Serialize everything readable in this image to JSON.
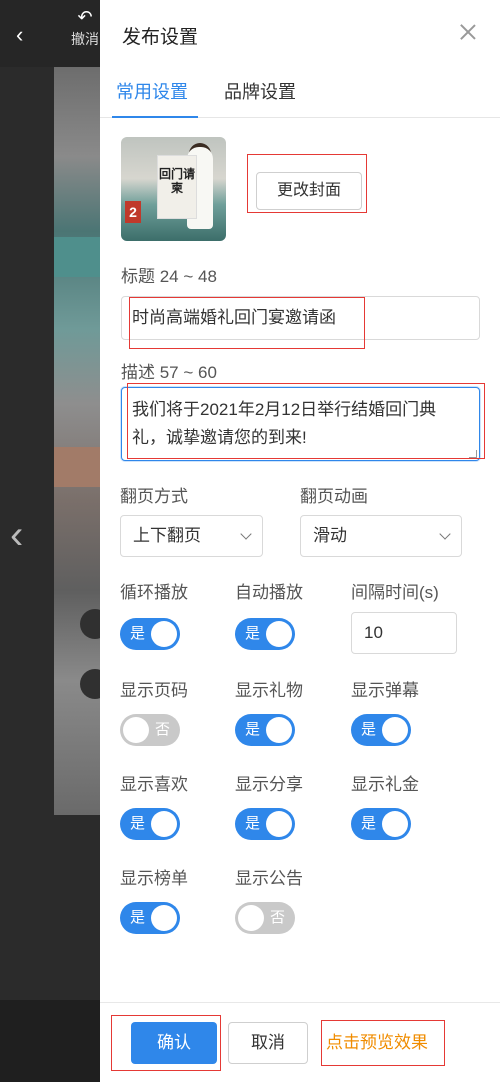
{
  "background": {
    "back_icon": "‹",
    "undo_label": "撤消",
    "prev_page_icon": "‹"
  },
  "panel": {
    "title": "发布设置",
    "tabs": [
      {
        "label": "常用设置",
        "active": true
      },
      {
        "label": "品牌设置",
        "active": false
      }
    ],
    "cover": {
      "thumb_text": "回门请柬",
      "thumb_number": "2",
      "change_button": "更改封面"
    },
    "title_field": {
      "label": "标题 24 ~ 48",
      "value": "时尚高端婚礼回门宴邀请函"
    },
    "desc_field": {
      "label": "描述 57 ~ 60",
      "value": "我们将于2021年2月12日举行结婚回门典礼，诚挚邀请您的到来!"
    },
    "page_mode": {
      "label": "翻页方式",
      "value": "上下翻页"
    },
    "page_anim": {
      "label": "翻页动画",
      "value": "滑动"
    },
    "toggles": {
      "loop": {
        "label": "循环播放",
        "state": "是",
        "on": true
      },
      "autoplay": {
        "label": "自动播放",
        "state": "是",
        "on": true
      },
      "page_num": {
        "label": "显示页码",
        "state": "否",
        "on": false
      },
      "gift": {
        "label": "显示礼物",
        "state": "是",
        "on": true
      },
      "danmaku": {
        "label": "显示弹幕",
        "state": "是",
        "on": true
      },
      "like": {
        "label": "显示喜欢",
        "state": "是",
        "on": true
      },
      "share": {
        "label": "显示分享",
        "state": "是",
        "on": true
      },
      "cash": {
        "label": "显示礼金",
        "state": "是",
        "on": true
      },
      "ranking": {
        "label": "显示榜单",
        "state": "是",
        "on": true
      },
      "notice": {
        "label": "显示公告",
        "state": "否",
        "on": false
      }
    },
    "interval": {
      "label": "间隔时间(s)",
      "value": "10"
    },
    "footer": {
      "confirm": "确认",
      "cancel": "取消",
      "preview": "点击预览效果"
    },
    "colors": {
      "accent": "#2f87ea",
      "highlight_box": "#e53935",
      "preview_link": "#f08c00"
    }
  }
}
